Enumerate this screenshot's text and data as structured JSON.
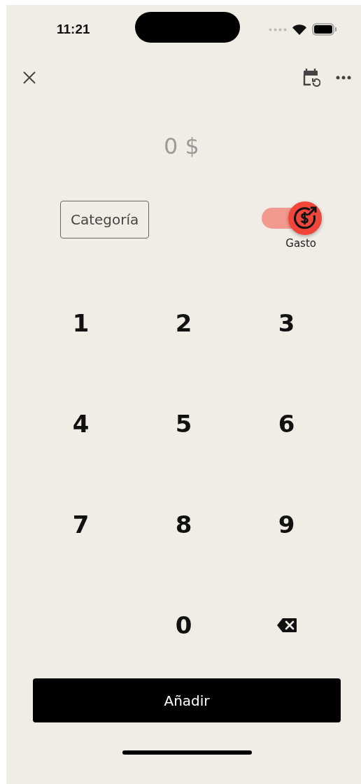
{
  "status_bar": {
    "time": "11:21"
  },
  "amount": "0 $",
  "category_button": "Categoría",
  "type_toggle": {
    "label": "Gasto",
    "on": true
  },
  "keypad": [
    {
      "kind": "digit",
      "label": "1"
    },
    {
      "kind": "digit",
      "label": "2"
    },
    {
      "kind": "digit",
      "label": "3"
    },
    {
      "kind": "digit",
      "label": "4"
    },
    {
      "kind": "digit",
      "label": "5"
    },
    {
      "kind": "digit",
      "label": "6"
    },
    {
      "kind": "digit",
      "label": "7"
    },
    {
      "kind": "digit",
      "label": "8"
    },
    {
      "kind": "digit",
      "label": "9"
    },
    {
      "kind": "blank"
    },
    {
      "kind": "digit",
      "label": "0"
    },
    {
      "kind": "backspace"
    }
  ],
  "submit_button": "Añadir"
}
